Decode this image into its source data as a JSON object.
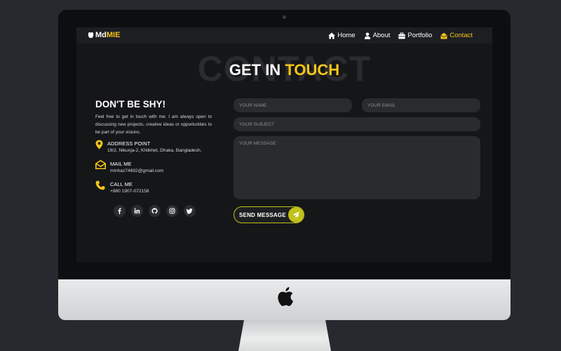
{
  "nav": {
    "brand_prefix": "Md",
    "brand_highlight": "MIE",
    "links": [
      {
        "label": "Home",
        "icon": "home-icon"
      },
      {
        "label": "About",
        "icon": "user-icon"
      },
      {
        "label": "Portfolio",
        "icon": "briefcase-icon"
      },
      {
        "label": "Contact",
        "icon": "envelope-open-icon",
        "active": true
      }
    ]
  },
  "hero": {
    "background_word": "CONTACT",
    "title_prefix": "GET IN ",
    "title_highlight": "TOUCH"
  },
  "contact_info": {
    "heading": "DON'T BE SHY!",
    "intro": "Feel free to get in touch with me. I am always open to discussing new projects, creative ideas or opportunities to be part of your visions.",
    "address_label": "ADDRESS POINT",
    "address_value": "19/2, Nikunja-2, Khilkhet, Dhaka, Bangladesh.",
    "mail_label": "MAIL ME",
    "mail_value": "minhaz74692@gmail.com",
    "call_label": "CALL ME",
    "call_value": "+880 1907-072158"
  },
  "socials": [
    "facebook-icon",
    "linkedin-icon",
    "github-icon",
    "instagram-icon",
    "twitter-icon"
  ],
  "form": {
    "name_placeholder": "YOUR NAME",
    "email_placeholder": "YOUR EMAIL",
    "subject_placeholder": "YOUR SUBJECT",
    "message_placeholder": "YOUR MESSAGE",
    "submit_label": "SEND MESSAGE"
  },
  "colors": {
    "accent": "#f5c518",
    "button_accent": "#c2c21a",
    "background": "#151618",
    "field": "#2a2b2e"
  }
}
